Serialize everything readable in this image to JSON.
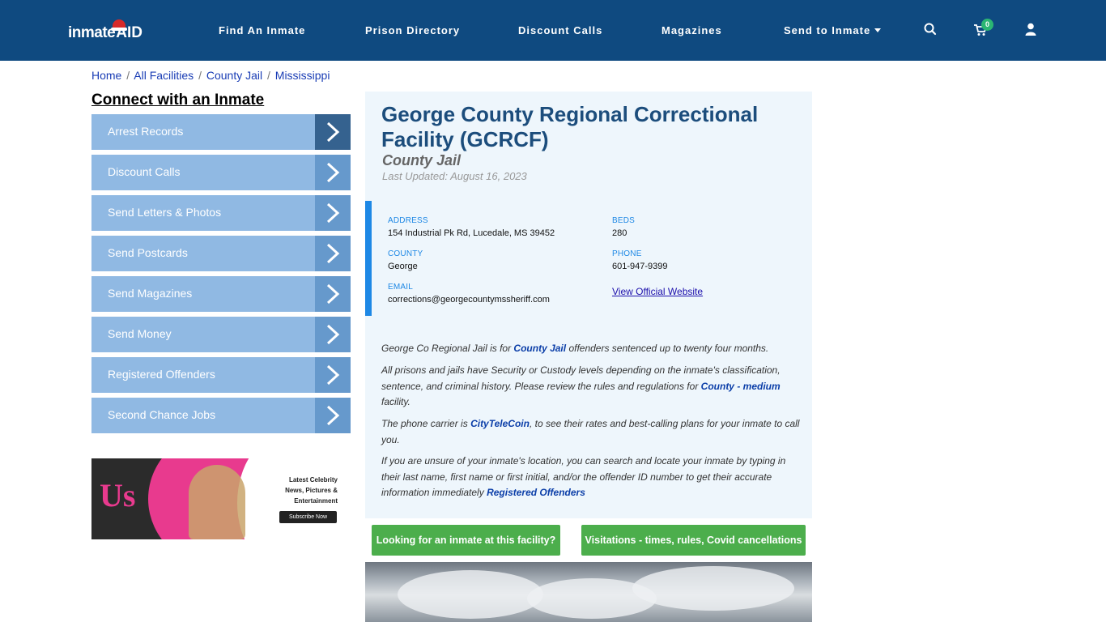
{
  "nav": {
    "logo_main": "inmate",
    "logo_accent": "AID",
    "links": [
      "Find An Inmate",
      "Prison Directory",
      "Discount Calls",
      "Magazines",
      "Send to Inmate"
    ],
    "cart_count": "0",
    "icons": [
      "search-icon",
      "cart-icon",
      "user-icon"
    ],
    "background_color": "#0f4a80"
  },
  "breadcrumb": {
    "items": [
      "Home",
      "All Facilities",
      "County Jail",
      "Mississippi"
    ],
    "separator": "/"
  },
  "sidebar": {
    "title": "Connect with an Inmate",
    "items": [
      "Arrest Records",
      "Discount Calls",
      "Send Letters & Photos",
      "Send Postcards",
      "Send Magazines",
      "Send Money",
      "Registered Offenders",
      "Second Chance Jobs"
    ],
    "ad": {
      "brand": "Us",
      "line1": "Latest Celebrity",
      "line2": "News, Pictures &",
      "line3": "Entertainment",
      "cta": "Subscribe Now"
    }
  },
  "facility": {
    "title": "George County Regional Correctional Facility (GCRCF)",
    "type": "County Jail",
    "last_updated": "Last Updated: August 16, 2023",
    "address_label": "ADDRESS",
    "address": "154 Industrial Pk Rd, Lucedale, MS 39452",
    "beds_label": "BEDS",
    "beds": "280",
    "county_label": "COUNTY",
    "county": "George",
    "phone_label": "PHONE",
    "phone": "601-947-9399",
    "email_label": "EMAIL",
    "email": "corrections@georgecountymssheriff.com",
    "website_link": "View Official Website"
  },
  "description": {
    "p1_a": "George Co Regional Jail is for ",
    "p1_link": "County Jail",
    "p1_b": " offenders sentenced up to twenty four months.",
    "p2_a": "All prisons and jails have Security or Custody levels depending on the inmate's classification, sentence, and criminal history. Please review the rules and regulations for ",
    "p2_link": "County - medium",
    "p2_b": " facility.",
    "p3_a": "The phone carrier is ",
    "p3_link": "CityTeleCoin",
    "p3_b": ", to see their rates and best-calling plans for your inmate to call you.",
    "p4_a": "If you are unsure of your inmate's location, you can search and locate your inmate by typing in their last name, first name or first initial, and/or the offender ID number to get their accurate information immediately ",
    "p4_link": "Registered Offenders"
  },
  "actions": {
    "find_inmate": "Looking for an inmate at this facility?",
    "visitations": "Visitations - times, rules, Covid cancellations"
  }
}
